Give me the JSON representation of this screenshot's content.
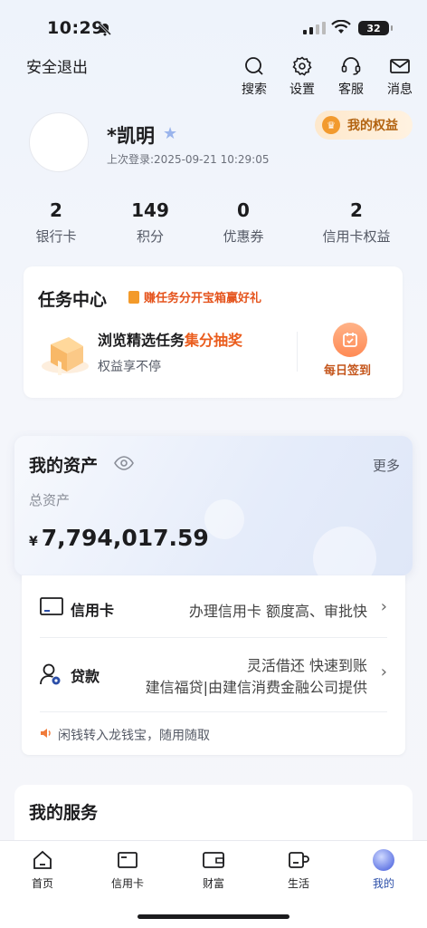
{
  "status_bar": {
    "time": "10:29",
    "battery": "32"
  },
  "header": {
    "logout_label": "安全退出",
    "actions": [
      {
        "label": "搜索",
        "icon": "search-icon"
      },
      {
        "label": "设置",
        "icon": "gear-icon"
      },
      {
        "label": "客服",
        "icon": "headset-icon"
      },
      {
        "label": "消息",
        "icon": "mail-icon"
      }
    ]
  },
  "profile": {
    "name": "*凯明",
    "last_login": "上次登录:2025-09-21 10:29:05",
    "perks_label": "我的权益"
  },
  "stats": [
    {
      "value": "2",
      "label": "银行卡"
    },
    {
      "value": "149",
      "label": "积分"
    },
    {
      "value": "0",
      "label": "优惠券"
    },
    {
      "value": "2",
      "label": "信用卡权益"
    }
  ],
  "task_center": {
    "title": "任务中心",
    "promo": "赚任务分开宝箱赢好礼",
    "task_prefix": "浏览精选任务",
    "task_highlight": "集分抽奖",
    "task_sub": "权益享不停",
    "checkin_label": "每日签到"
  },
  "assets": {
    "title": "我的资产",
    "more_label": "更多",
    "total_label": "总资产",
    "currency": "¥",
    "total_value": "7,794,017.59"
  },
  "products": {
    "credit_card": {
      "label": "信用卡",
      "desc": "办理信用卡 额度高、审批快"
    },
    "loan": {
      "label": "贷款",
      "desc_line1": "灵活借还 快速到账",
      "desc_line2": "建信福贷|由建信消费金融公司提供"
    },
    "notice": "闲钱转入龙钱宝，随用随取"
  },
  "services": {
    "title": "我的服务"
  },
  "tabbar": [
    {
      "label": "首页",
      "icon": "home-icon"
    },
    {
      "label": "信用卡",
      "icon": "card-icon"
    },
    {
      "label": "财富",
      "icon": "wallet-icon"
    },
    {
      "label": "生活",
      "icon": "cup-icon"
    },
    {
      "label": "我的",
      "icon": "me-icon",
      "active": true
    }
  ],
  "colors": {
    "accent_orange": "#ea5c1c",
    "active_tab": "#2b4ea8",
    "star": "#9ab4ec"
  }
}
